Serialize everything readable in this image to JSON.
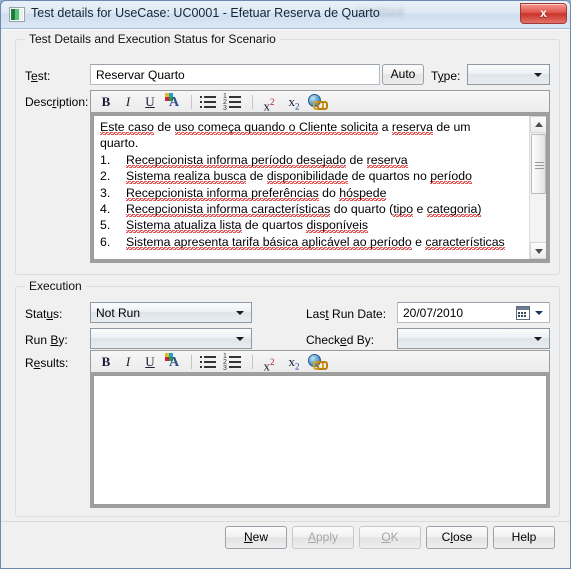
{
  "window": {
    "title": "Test details for UseCase: UC0001 - Efetuar Reserva de Quarto",
    "icon": "application-icon",
    "close_label": "x",
    "ghost_text": "Untitled"
  },
  "details_group": {
    "legend": "Test Details and Execution Status for Scenario",
    "test_label_pre": "T",
    "test_label_acc": "e",
    "test_label_post": "st:",
    "test_value": "Reservar Quarto",
    "auto_button": "Auto",
    "type_label_pre": "T",
    "type_label_acc": "y",
    "type_label_post": "pe:",
    "type_value": "",
    "description_label_pre": "Desc",
    "description_label_acc": "r",
    "description_label_post": "iption:"
  },
  "toolbar": {
    "bold": "B",
    "italic": "I",
    "underline": "U",
    "font_color": "A",
    "bullet_list": "bullet-list",
    "numbered_list": "numbered-list",
    "superscript": "x",
    "superscript_sup": "2",
    "subscript": "x",
    "subscript_sub": "2",
    "hyperlink": "hyperlink"
  },
  "description_text": {
    "lines": [
      "Este caso de uso começa quando o Cliente solicita a reserva de um",
      "quarto.",
      "1.\tRecepcionista informa período desejado de reserva",
      "2.\tSistema realiza busca de disponibilidade de quartos no período",
      "3.\tRecepcionista informa preferências do hóspede",
      "4.\tRecepcionista informa características do quarto (tipo e categoria)",
      "5.\tSistema atualiza lista de quartos disponíveis",
      "6.\tSistema apresenta tarifa básica aplicável ao período e características"
    ],
    "l1a": "Este caso",
    "l1b": " de ",
    "l1c": "uso começa quando o Cliente solicita",
    "l1d": " a ",
    "l1e": "reserva",
    "l1f": " de um",
    "l2": "quarto.",
    "n3": "1.",
    "l3a": "Recepcionista informa período desejado",
    "l3b": " de ",
    "l3c": "reserva",
    "n4": "2.",
    "l4a": "Sistema realiza busca",
    "l4b": " de ",
    "l4c": "disponibilidade",
    "l4d": " de quartos no ",
    "l4e": "período",
    "n5": "3.",
    "l5a": "Recepcionista informa preferências",
    "l5b": " do ",
    "l5c": "hóspede",
    "n6": "4.",
    "l6a": "Recepcionista informa características",
    "l6b": " do quarto (",
    "l6c": "tipo",
    "l6d": " e ",
    "l6e": "categoria)",
    "n7": "5.",
    "l7a": "Sistema atualiza lista",
    "l7b": " de quartos ",
    "l7c": "disponíveis",
    "n8": "6.",
    "l8a": "Sistema apresenta tarifa básica aplicável ao período",
    "l8b": " e ",
    "l8c": "características"
  },
  "execution_group": {
    "legend": "Execution",
    "status_label_pre": "Stat",
    "status_label_acc": "u",
    "status_label_post": "s:",
    "status_value": "Not Run",
    "run_by_label_pre": "Run ",
    "run_by_label_acc": "B",
    "run_by_label_post": "y:",
    "run_by_value": "",
    "last_run_date_label_pre": "Las",
    "last_run_date_label_acc": "t",
    "last_run_date_label_post": " Run Date:",
    "last_run_date_value": "20/07/2010",
    "checked_by_label_pre": "Check",
    "checked_by_label_acc": "e",
    "checked_by_label_post": "d By:",
    "checked_by_value": "",
    "results_label_pre": "R",
    "results_label_acc": "e",
    "results_label_post": "sults:",
    "results_value": ""
  },
  "footer": {
    "buttons": [
      {
        "name": "new",
        "pre": "",
        "acc": "N",
        "post": "ew",
        "enabled": true
      },
      {
        "name": "apply",
        "pre": "",
        "acc": "A",
        "post": "pply",
        "enabled": false
      },
      {
        "name": "ok",
        "pre": "",
        "acc": "O",
        "post": "K",
        "enabled": false
      },
      {
        "name": "close",
        "pre": "C",
        "acc": "l",
        "post": "ose",
        "enabled": true
      },
      {
        "name": "help",
        "pre": "He",
        "acc": "",
        "post": "lp",
        "enabled": true
      }
    ],
    "new_label": "New",
    "apply_label": "Apply",
    "ok_label": "OK",
    "close_label": "Close",
    "help_label": "Help"
  },
  "colors": {
    "dialog_bg": "#f0f0f0",
    "close_red": "#c9322a",
    "spell_underline": "#e02020",
    "title_text": "#11263c"
  }
}
